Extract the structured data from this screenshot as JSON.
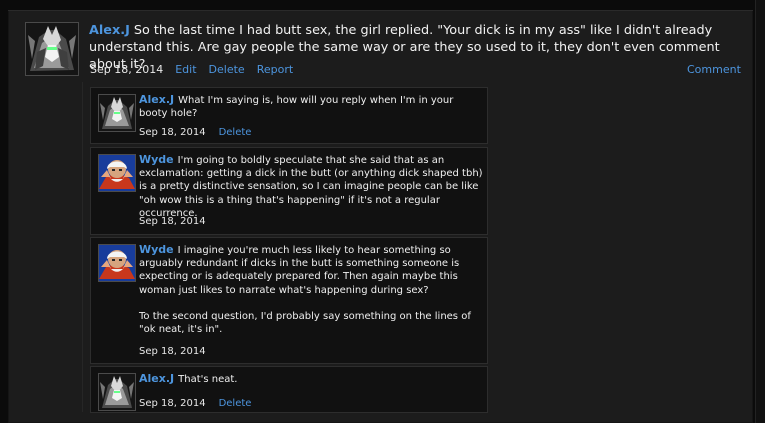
{
  "post": {
    "author": "Alex.J",
    "text": "So the last time I had butt sex, the girl replied. \"Your dick is in my ass\" like I didn't already understand this. Are gay people the same way or are they so used to it, they don't even comment about it?",
    "date": "Sep 18, 2014",
    "actions": {
      "edit": "Edit",
      "delete": "Delete",
      "report": "Report",
      "comment": "Comment"
    }
  },
  "replies": [
    {
      "author": "Alex.J",
      "text": "What I'm saying is, how will you reply when I'm in your booty hole?",
      "date": "Sep 18, 2014",
      "action": "Delete",
      "avatar": "robot-avatar"
    },
    {
      "author": "Wyde",
      "text": "I'm going to boldly speculate that she said that as an exclamation: getting a dick in the butt (or anything dick shaped tbh) is a pretty distinctive sensation, so I can imagine people can be like \"oh wow this is a thing that's happening\" if it's not a regular occurrence.",
      "date": "Sep 18, 2014",
      "avatar": "wrestler-avatar"
    },
    {
      "author": "Wyde",
      "text": "I imagine you're much less likely to hear something so arguably redundant if dicks in the butt is something someone is expecting or is adequately prepared for. Then again maybe this woman just likes to narrate what's happening during sex?",
      "text2": "To the second question, I'd probably say something on the lines of \"ok neat, it's in\".",
      "date": "Sep 18, 2014",
      "avatar": "wrestler-avatar"
    },
    {
      "author": "Alex.J",
      "text": "That's neat.",
      "date": "Sep 18, 2014",
      "action": "Delete",
      "avatar": "robot-avatar"
    }
  ],
  "colors": {
    "background": "#0b0b0b",
    "panel": "#1c1c1c",
    "reply": "#111111",
    "link": "#4d95de",
    "text": "#f0f0f0"
  }
}
